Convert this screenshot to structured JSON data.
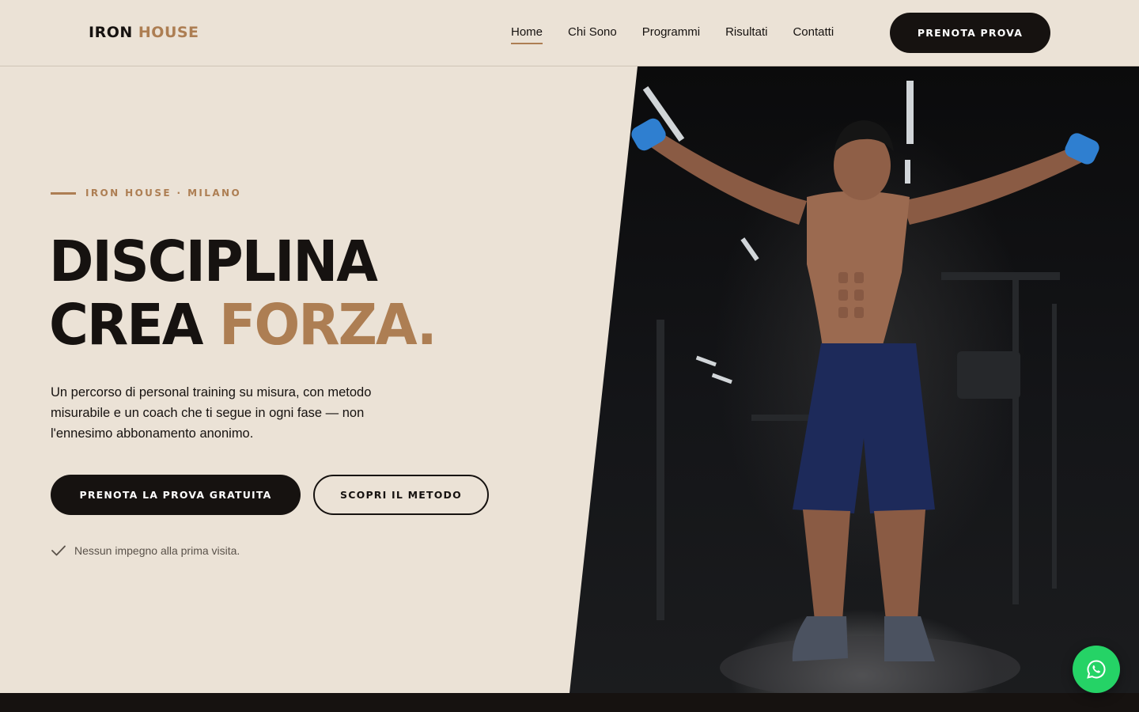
{
  "brand": {
    "name_part1": "IRON",
    "name_part2": "HOUSE",
    "accent_color": "#ad7e53",
    "dark_color": "#161210",
    "background_color": "#ebe2d6"
  },
  "nav": {
    "items": [
      {
        "label": "Home",
        "active": true
      },
      {
        "label": "Chi Sono",
        "active": false
      },
      {
        "label": "Programmi",
        "active": false
      },
      {
        "label": "Risultati",
        "active": false
      },
      {
        "label": "Contatti",
        "active": false
      }
    ],
    "cta_label": "PRENOTA PROVA"
  },
  "hero": {
    "eyebrow": "IRON HOUSE · MILANO",
    "headline_line1": "DISCIPLINA",
    "headline_line2_part1": "CREA",
    "headline_line2_accent": "FORZA.",
    "lead": "Un percorso di personal training su misura, con metodo misurabile e un coach che ti segue in ogni fase — non l'ennesimo abbonamento anonimo.",
    "primary_button": "PRENOTA LA PROVA GRATUITA",
    "secondary_button": "SCOPRI IL METODO",
    "note": "Nessun impegno alla prima visita.",
    "note_icon": "check-icon",
    "image": "muscular-man-holding-dumbbells-in-dark-gym"
  },
  "floating": {
    "whatsapp_icon": "whatsapp-icon",
    "whatsapp_color": "#25d366"
  }
}
